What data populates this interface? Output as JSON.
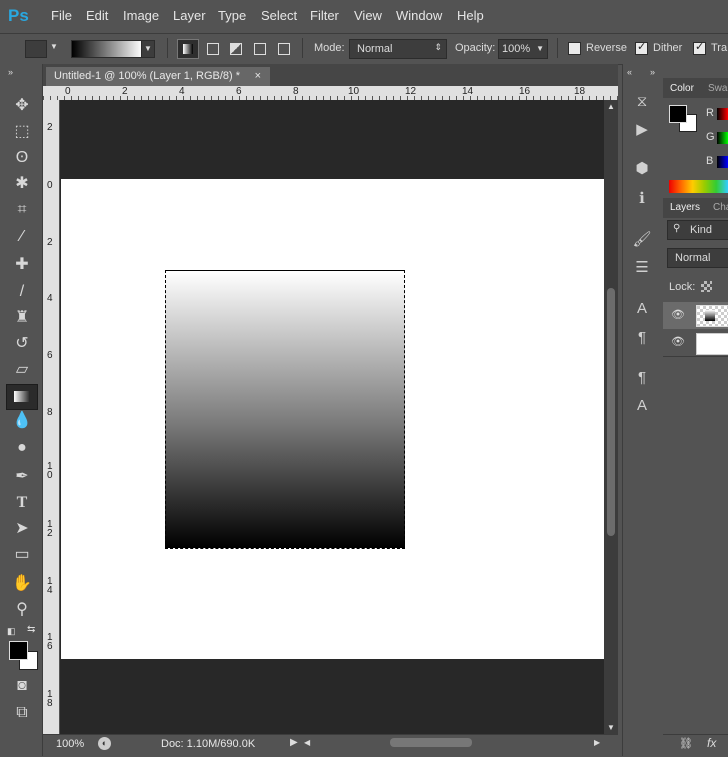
{
  "app": {
    "logo": "Ps"
  },
  "menu": [
    "File",
    "Edit",
    "Image",
    "Layer",
    "Type",
    "Select",
    "Filter",
    "View",
    "Window",
    "Help"
  ],
  "options": {
    "mode_label": "Mode:",
    "mode_value": "Normal",
    "opacity_label": "Opacity:",
    "opacity_value": "100%",
    "reverse": "Reverse",
    "dither": "Dither",
    "transparency": "Tra"
  },
  "document": {
    "tab_title": "Untitled-1 @ 100% (Layer 1, RGB/8) *",
    "ruler_h": [
      "0",
      "2",
      "4",
      "6",
      "8",
      "10",
      "12",
      "14",
      "16",
      "18"
    ],
    "ruler_v": [
      "2",
      "0",
      "2",
      "4",
      "6",
      "8",
      "1 0",
      "1 2",
      "1 4",
      "1 6",
      "1 8"
    ]
  },
  "status": {
    "zoom": "100%",
    "doc": "Doc: 1.10M/690.0K"
  },
  "panels": {
    "color_tab": "Color",
    "swatches_tab": "Swa",
    "channels": [
      "R",
      "G",
      "B"
    ],
    "layers_tab": "Layers",
    "channels_tab": "Cha",
    "kind": "Kind",
    "blend": "Normal",
    "lock": "Lock:"
  },
  "colors": {
    "accent": "#29a8e0",
    "ui_bg": "#535353",
    "pasteboard": "#282828"
  }
}
